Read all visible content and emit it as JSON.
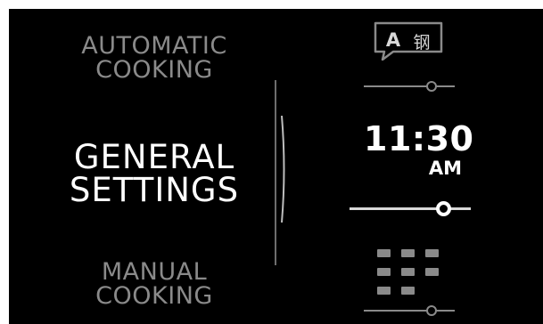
{
  "menu": {
    "automatic_cooking": "AUTOMATIC\nCOOKING",
    "general_settings": "GENERAL\nSETTINGS",
    "manual_cooking": "MANUAL\nCOOKING"
  },
  "language_icon": {
    "icon": "language-speech-bubble-icon",
    "letter": "A",
    "glyph": "钢"
  },
  "clock": {
    "time": "11:30",
    "ampm": "AM"
  },
  "keypad_icon": {
    "icon": "keypad-grid-icon"
  },
  "colors": {
    "background": "#000000",
    "active_text": "#ffffff",
    "inactive_text": "#8a8a8a"
  }
}
